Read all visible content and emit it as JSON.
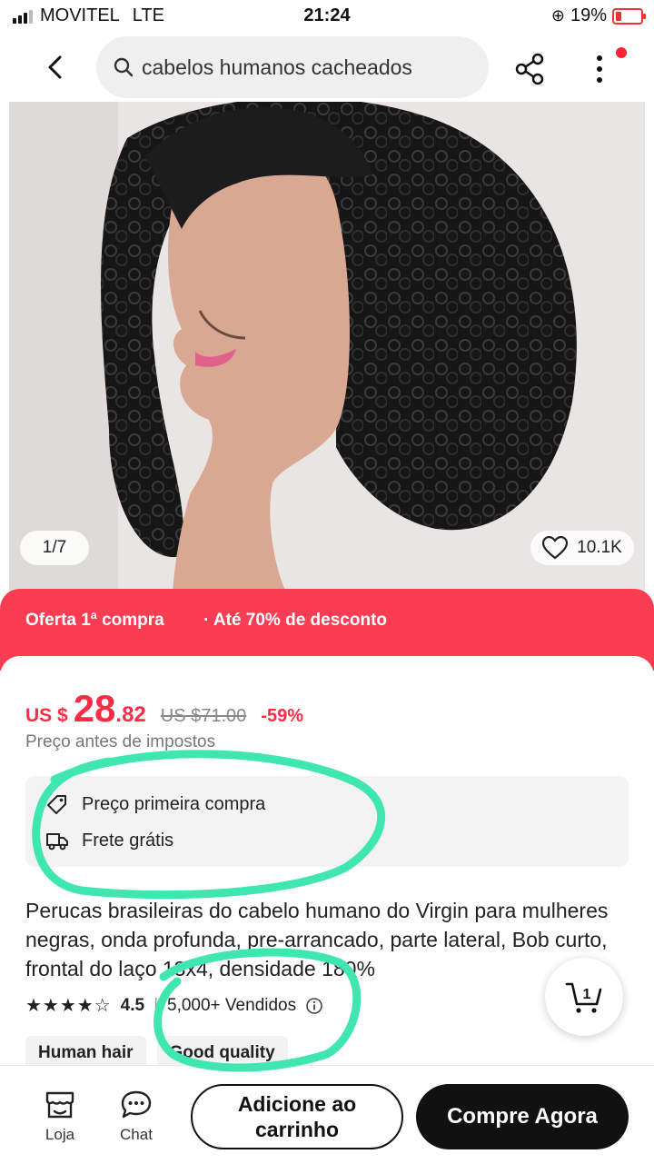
{
  "status_bar": {
    "carrier": "MOVITEL",
    "network": "LTE",
    "time": "21:24",
    "battery": "19%"
  },
  "header": {
    "search_text": "cabelos humanos cacheados"
  },
  "gallery": {
    "position": "1/7",
    "likes": "10.1K"
  },
  "promo": {
    "label": "Oferta 1ª compra",
    "discount": "· Até 70% de desconto"
  },
  "price": {
    "currency": "US $",
    "integer": "28",
    "cents": ".82",
    "original": "US $71.00",
    "discount": "-59%",
    "tax_note": "Preço antes de impostos"
  },
  "benefits": {
    "first_purchase": "Preço primeira compra",
    "shipping": "Frete grátis"
  },
  "product": {
    "title": "Perucas brasileiras do cabelo humano do Virgin para mulheres negras, onda profunda, pre-arrancado, parte lateral, Bob curto, frontal do laço 13x4, densidade 180%",
    "rating": "4.5",
    "sold": "5,000+ Vendidos",
    "tags": [
      "Human hair",
      "Good quality"
    ]
  },
  "cart": {
    "count": "1"
  },
  "bottom_nav": {
    "store_label": "Loja",
    "chat_label": "Chat",
    "add_to_cart": "Adicione ao carrinho",
    "buy_now": "Compre Agora"
  },
  "colors": {
    "accent": "#fb2d46",
    "promo_bg": "#fb3d54",
    "annotation": "#3fe6b0"
  },
  "icons": [
    "back-icon",
    "search-icon",
    "share-icon",
    "more-icon",
    "heart-icon",
    "tag-icon",
    "truck-icon",
    "info-icon",
    "cart-icon",
    "store-icon",
    "chat-icon"
  ]
}
